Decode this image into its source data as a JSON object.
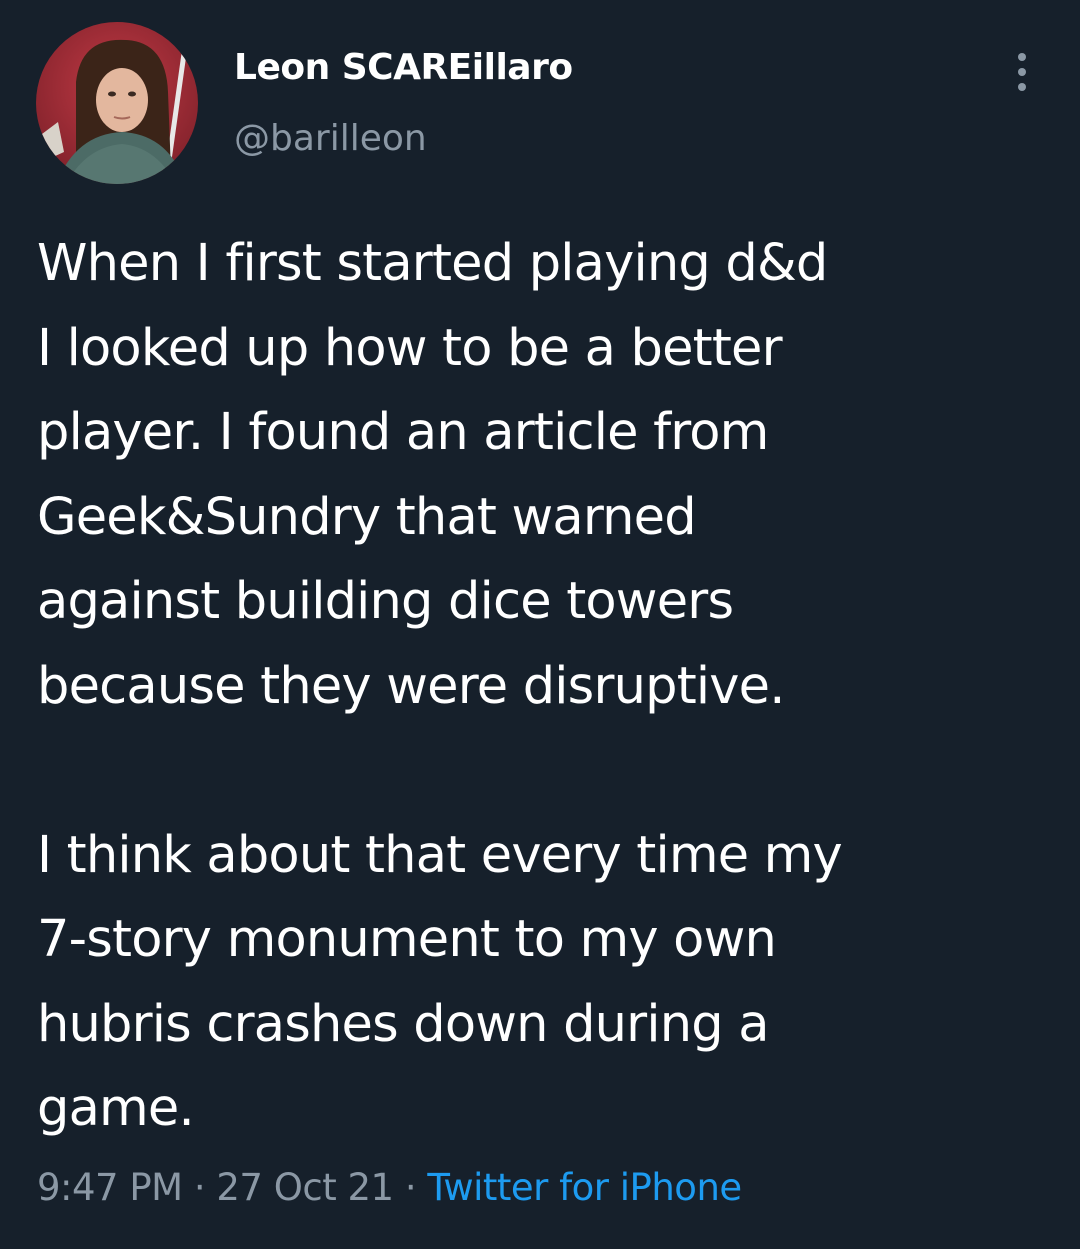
{
  "user": {
    "display_name": "Leon SCAREillaro",
    "handle": "@barilleon",
    "avatar_icon": "profile-photo"
  },
  "tweet": {
    "text": "When I first started playing d&d\nI looked up how to be a better\nplayer. I found an article from\nGeek&Sundry that warned\nagainst building dice towers\nbecause they were disruptive.\n\nI think about that every time my\n7-story monument to my own\nhubris crashes down during a\ngame."
  },
  "meta": {
    "time": "9:47 PM",
    "separator1": " · ",
    "date": "27 Oct 21",
    "separator2": " · ",
    "source": "Twitter for iPhone"
  },
  "icons": {
    "more": "more-vertical-icon"
  },
  "colors": {
    "background": "#16202b",
    "text": "#ffffff",
    "secondary_text": "#8b98a5",
    "link": "#1d9bf0"
  }
}
